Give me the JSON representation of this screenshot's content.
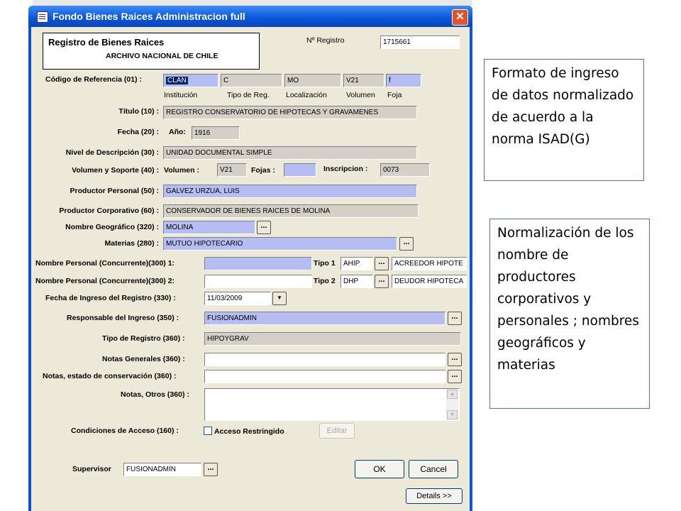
{
  "window": {
    "title": "Fondo Bienes Raices Administracion full",
    "close_glyph": "✕",
    "icon": "form-icon"
  },
  "header_box": {
    "title": "Registro de Bienes Raices",
    "subtitle": "ARCHIVO NACIONAL DE CHILE"
  },
  "registro": {
    "label": "Nº Registro",
    "value": "1715661"
  },
  "codigo": {
    "label": "Código de Referencia (01) :",
    "fields": [
      {
        "value": "CLAN",
        "caption": "Institución"
      },
      {
        "value": "C",
        "caption": "Tipo de Reg."
      },
      {
        "value": "MO",
        "caption": "Localización"
      },
      {
        "value": "V21",
        "caption": "Volumen"
      },
      {
        "value": "f",
        "caption": "Foja"
      }
    ]
  },
  "titulo": {
    "label": "Título (10) :",
    "value": "REGISTRO CONSERVATORIO DE HIPOTECAS Y GRAVAMENES"
  },
  "fecha": {
    "label": "Fecha (20) :",
    "year_label": "Año:",
    "value": "1916"
  },
  "nivel": {
    "label": "Nivel de Descripción (30) :",
    "value": "UNIDAD DOCUMENTAL SIMPLE"
  },
  "volumen": {
    "label": "Volumen y Soporte (40) :",
    "volumen_label": "Volumen :",
    "volumen_value": "V21",
    "fojas_label": "Fojas :",
    "fojas_value": "",
    "inscripcion_label": "Inscripcion :",
    "inscripcion_value": "0073"
  },
  "productor_personal": {
    "label": "Productor Personal (50) :",
    "value": "GALVEZ URZUA, LUIS"
  },
  "productor_corporativo": {
    "label": "Productor Corporativo (60) :",
    "value": "CONSERVADOR DE BIENES RAICES DE MOLINA"
  },
  "nombre_geografico": {
    "label": "Nombre Geográfico (320) :",
    "value": "MOLINA"
  },
  "materias": {
    "label": "Materias (280) :",
    "value": "MUTUO HIPOTECARIO"
  },
  "nombre_personal_1": {
    "label": "Nombre Personal (Concurrente)(300) 1:",
    "value": "",
    "tipo_label": "Tipo 1",
    "tipo_code": "AHIP",
    "tipo_desc": "ACREEDOR HIPOTE"
  },
  "nombre_personal_2": {
    "label": "Nombre Personal (Concurrente)(300) 2:",
    "value": "",
    "tipo_label": "Tipo 2",
    "tipo_code": "DHP",
    "tipo_desc": "DEUDOR HIPOTECA"
  },
  "fecha_ingreso": {
    "label": "Fecha de Ingreso del Registro (330) :",
    "value": "11/03/2009",
    "dropdown_glyph": "▼"
  },
  "responsable": {
    "label": "Responsable del Ingreso (350) :",
    "value": "FUSIONADMIN"
  },
  "tipo_registro": {
    "label": "Tipo de Registro (360) :",
    "value": "HIPOYGRAV"
  },
  "notas_generales": {
    "label": "Notas Generales (360) :",
    "value": ""
  },
  "notas_conservacion": {
    "label": "Notas, estado de conservación (360) :",
    "value": ""
  },
  "notas_otros": {
    "label": "Notas, Otros (360) :",
    "value": ""
  },
  "condiciones": {
    "label": "Condiciones de Acceso (160) :",
    "checkbox_label": "Acceso Restringido",
    "checked": false,
    "edit_button": "Editar"
  },
  "supervisor": {
    "label": "Supervisor",
    "value": "FUSIONADMIN"
  },
  "buttons": {
    "ellipsis": "...",
    "ok": "OK",
    "cancel": "Cancel",
    "details": "Details >>"
  },
  "callouts": [
    "Formato de ingreso de datos normalizado de acuerdo a la norma ISAD(G)",
    "Normalización de los nombre de productores corporativos y personales ; nombres geográficos y materias"
  ],
  "colors": {
    "titlebar": "#0a55d6",
    "client_bg": "#ece9d8",
    "required_field": "#b6bdf2",
    "readonly_field": "#d4d0c8",
    "callout_border": "#4472c4"
  }
}
